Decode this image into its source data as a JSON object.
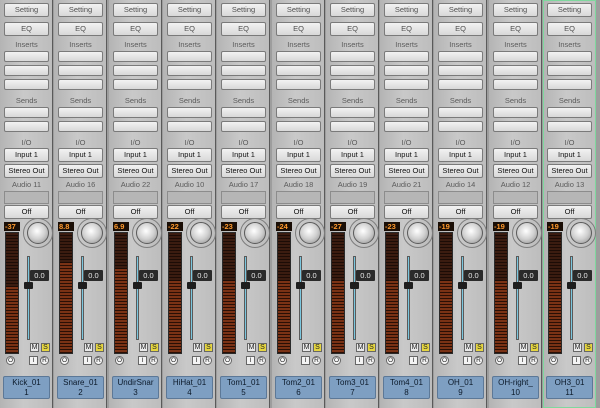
{
  "labels": {
    "setting": "Setting",
    "eq": "EQ",
    "inserts": "Inserts",
    "sends": "Sends",
    "io": "I/O",
    "automation": "Off",
    "mute": "M",
    "solo": "S",
    "monitor": "O",
    "input_monitor": "I",
    "record": "R"
  },
  "channels": [
    {
      "name": "Kick_01",
      "number": "1",
      "input": "Input 1",
      "output": "Stereo Out",
      "audio": "Audio 11",
      "peak": "-37",
      "volume": "0.0",
      "meter_level": 0.55
    },
    {
      "name": "Snare_01",
      "number": "2",
      "input": "Input 1",
      "output": "Stereo Out",
      "audio": "Audio 16",
      "peak": "8.8",
      "volume": "0.0",
      "meter_level": 0.75
    },
    {
      "name": "UndirSnar",
      "number": "3",
      "input": "Input 1",
      "output": "Stereo Out",
      "audio": "Audio 22",
      "peak": "6.9",
      "volume": "0.0",
      "meter_level": 0.7
    },
    {
      "name": "HiHat_01",
      "number": "4",
      "input": "Input 1",
      "output": "Stereo Out",
      "audio": "Audio 10",
      "peak": "-22",
      "volume": "0.0",
      "meter_level": 0.6
    },
    {
      "name": "Tom1_01",
      "number": "5",
      "input": "Input 1",
      "output": "Stereo Out",
      "audio": "Audio 17",
      "peak": "-23",
      "volume": "0.0",
      "meter_level": 0.6
    },
    {
      "name": "Tom2_01",
      "number": "6",
      "input": "Input 1",
      "output": "Stereo Out",
      "audio": "Audio 18",
      "peak": "-24",
      "volume": "0.0",
      "meter_level": 0.6
    },
    {
      "name": "Tom3_01",
      "number": "7",
      "input": "Input 1",
      "output": "Stereo Out",
      "audio": "Audio 19",
      "peak": "-27",
      "volume": "0.0",
      "meter_level": 0.6
    },
    {
      "name": "Tom4_01",
      "number": "8",
      "input": "Input 1",
      "output": "Stereo Out",
      "audio": "Audio 21",
      "peak": "-23",
      "volume": "0.0",
      "meter_level": 0.6
    },
    {
      "name": "OH_01",
      "number": "9",
      "input": "Input 1",
      "output": "Stereo Out",
      "audio": "Audio 14",
      "peak": "-19",
      "volume": "0.0",
      "meter_level": 0.6
    },
    {
      "name": "OH-right_",
      "number": "10",
      "input": "Input 1",
      "output": "Stereo Out",
      "audio": "Audio 12",
      "peak": "-19",
      "volume": "0.0",
      "meter_level": 0.6
    },
    {
      "name": "OH3_01",
      "number": "11",
      "input": "Input 1",
      "output": "Stereo Out",
      "audio": "Audio 13",
      "peak": "-19",
      "volume": "0.0",
      "meter_level": 0.6,
      "selected": true
    }
  ],
  "colors": {
    "peak_text": "#ff9a2e",
    "solo": "#e6d640",
    "name_plate": "#7e9fc2",
    "fader_track": "#7ac7df",
    "selected_outline": "#7fd89e"
  }
}
